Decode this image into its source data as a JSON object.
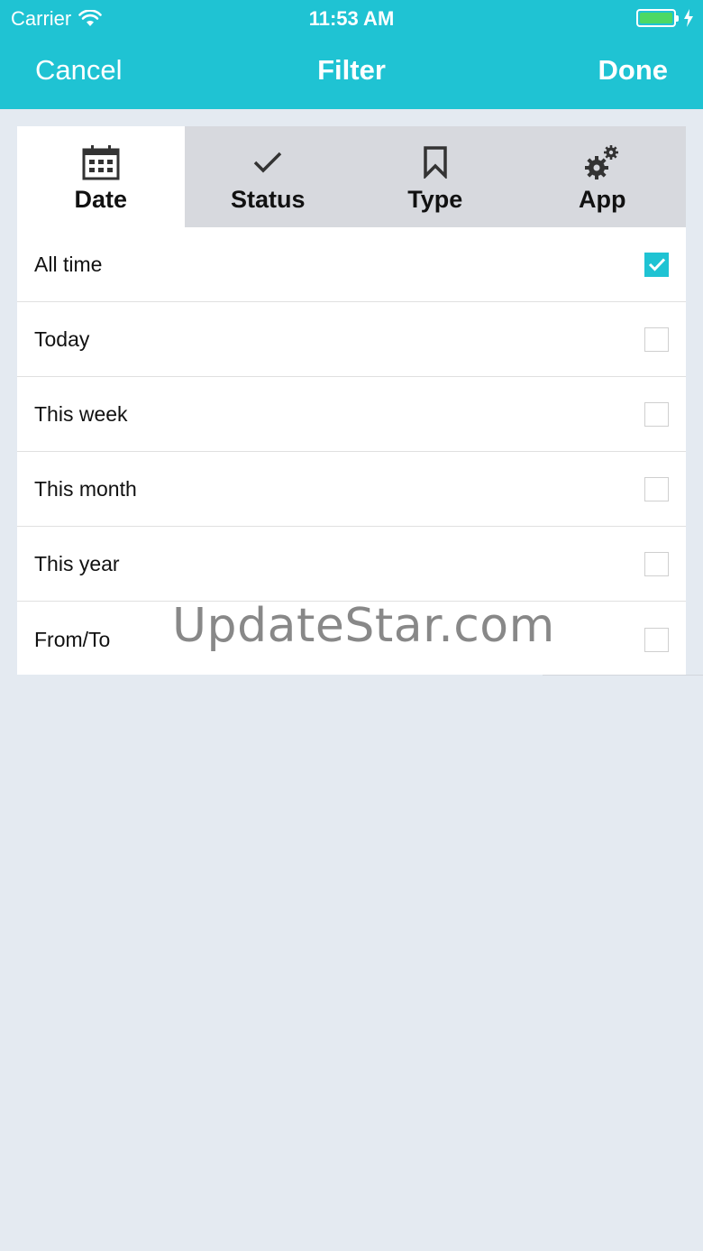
{
  "status_bar": {
    "carrier": "Carrier",
    "time": "11:53 AM"
  },
  "nav": {
    "cancel_label": "Cancel",
    "title": "Filter",
    "done_label": "Done"
  },
  "tabs": [
    {
      "label": "Date",
      "icon": "calendar-icon",
      "active": true
    },
    {
      "label": "Status",
      "icon": "check-icon",
      "active": false
    },
    {
      "label": "Type",
      "icon": "bookmark-icon",
      "active": false
    },
    {
      "label": "App",
      "icon": "gears-icon",
      "active": false
    }
  ],
  "options": [
    {
      "label": "All time",
      "checked": true
    },
    {
      "label": "Today",
      "checked": false
    },
    {
      "label": "This week",
      "checked": false
    },
    {
      "label": "This month",
      "checked": false
    },
    {
      "label": "This year",
      "checked": false
    },
    {
      "label": "From/To",
      "checked": false
    }
  ],
  "watermark": "UpdateStar.com",
  "colors": {
    "accent": "#1fc3d3",
    "background": "#e4eaf1",
    "battery": "#4cd964"
  }
}
